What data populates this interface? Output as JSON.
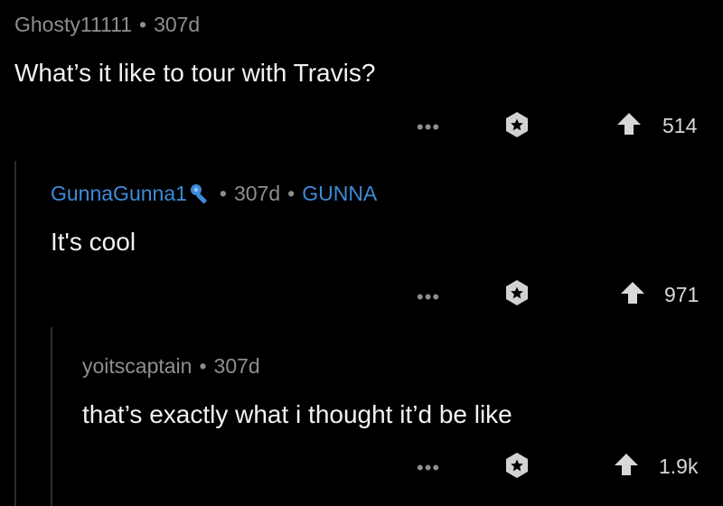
{
  "comments": [
    {
      "username": "Ghosty11111",
      "separator": "•",
      "age": "307d",
      "body": "What’s it like to tour with Travis?",
      "score": "514"
    },
    {
      "username": "GunnaGunna1",
      "separator": "•",
      "age": "307d",
      "flair": "GUNNA",
      "body": "It's cool",
      "score": "971"
    },
    {
      "username": "yoitscaptain",
      "separator": "•",
      "age": "307d",
      "body": "that’s exactly what i thought it’d be like",
      "score": "1.9k"
    }
  ],
  "icons": {
    "more": "more-options-icon",
    "award": "award-icon",
    "upvote": "upvote-icon",
    "mic": "microphone-icon"
  },
  "colors": {
    "background": "#000000",
    "meta_text": "#8e8e8e",
    "body_text": "#f2f2f2",
    "mod_blue": "#3d8bd9",
    "thread_line": "#2a2a2a"
  }
}
